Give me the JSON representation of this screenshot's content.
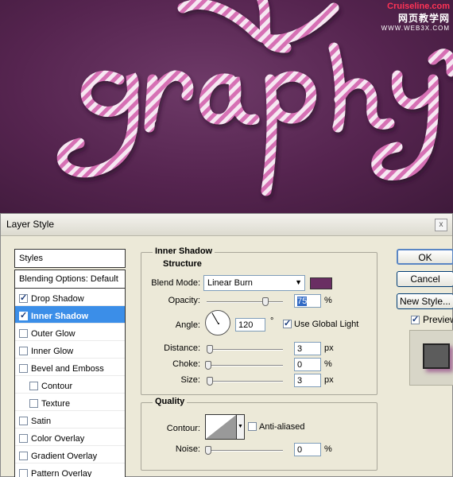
{
  "watermark": {
    "site": "Cruiseline.com",
    "cn": "网页教学网",
    "url": "WWW.WEB3X.COM"
  },
  "dialog": {
    "title": "Layer Style",
    "close_glyph": "x",
    "buttons": {
      "ok": "OK",
      "cancel": "Cancel",
      "new_style": "New Style..."
    },
    "preview": {
      "label": "Preview",
      "checked": true
    }
  },
  "sidebar": {
    "styles_header": "Styles",
    "blending": "Blending Options: Default",
    "items": [
      {
        "label": "Drop Shadow",
        "checked": true,
        "selected": false,
        "sub": false
      },
      {
        "label": "Inner Shadow",
        "checked": true,
        "selected": true,
        "sub": false
      },
      {
        "label": "Outer Glow",
        "checked": false,
        "selected": false,
        "sub": false
      },
      {
        "label": "Inner Glow",
        "checked": false,
        "selected": false,
        "sub": false
      },
      {
        "label": "Bevel and Emboss",
        "checked": false,
        "selected": false,
        "sub": false
      },
      {
        "label": "Contour",
        "checked": false,
        "selected": false,
        "sub": true
      },
      {
        "label": "Texture",
        "checked": false,
        "selected": false,
        "sub": true
      },
      {
        "label": "Satin",
        "checked": false,
        "selected": false,
        "sub": false
      },
      {
        "label": "Color Overlay",
        "checked": false,
        "selected": false,
        "sub": false
      },
      {
        "label": "Gradient Overlay",
        "checked": false,
        "selected": false,
        "sub": false
      },
      {
        "label": "Pattern Overlay",
        "checked": false,
        "selected": false,
        "sub": false
      }
    ]
  },
  "panel": {
    "title": "Inner Shadow",
    "structure": {
      "title": "Structure",
      "blend_mode_label": "Blend Mode:",
      "blend_mode": "Linear Burn",
      "blend_color": "#6a2e63",
      "opacity_label": "Opacity:",
      "opacity": "75",
      "opacity_unit": "%",
      "angle_label": "Angle:",
      "angle": "120",
      "angle_unit": "°",
      "global_light_label": "Use Global Light",
      "global_light": true,
      "distance_label": "Distance:",
      "distance": "3",
      "distance_unit": "px",
      "choke_label": "Choke:",
      "choke": "0",
      "choke_unit": "%",
      "size_label": "Size:",
      "size": "3",
      "size_unit": "px"
    },
    "quality": {
      "title": "Quality",
      "contour_label": "Contour:",
      "antialiased_label": "Anti-aliased",
      "antialiased": false,
      "noise_label": "Noise:",
      "noise": "0",
      "noise_unit": "%"
    }
  },
  "colors": {
    "selection": "#3b8ee8",
    "dialog_bg": "#ece9d8",
    "art_bg": "#55244f",
    "rope_pink": "#e07ec0"
  }
}
